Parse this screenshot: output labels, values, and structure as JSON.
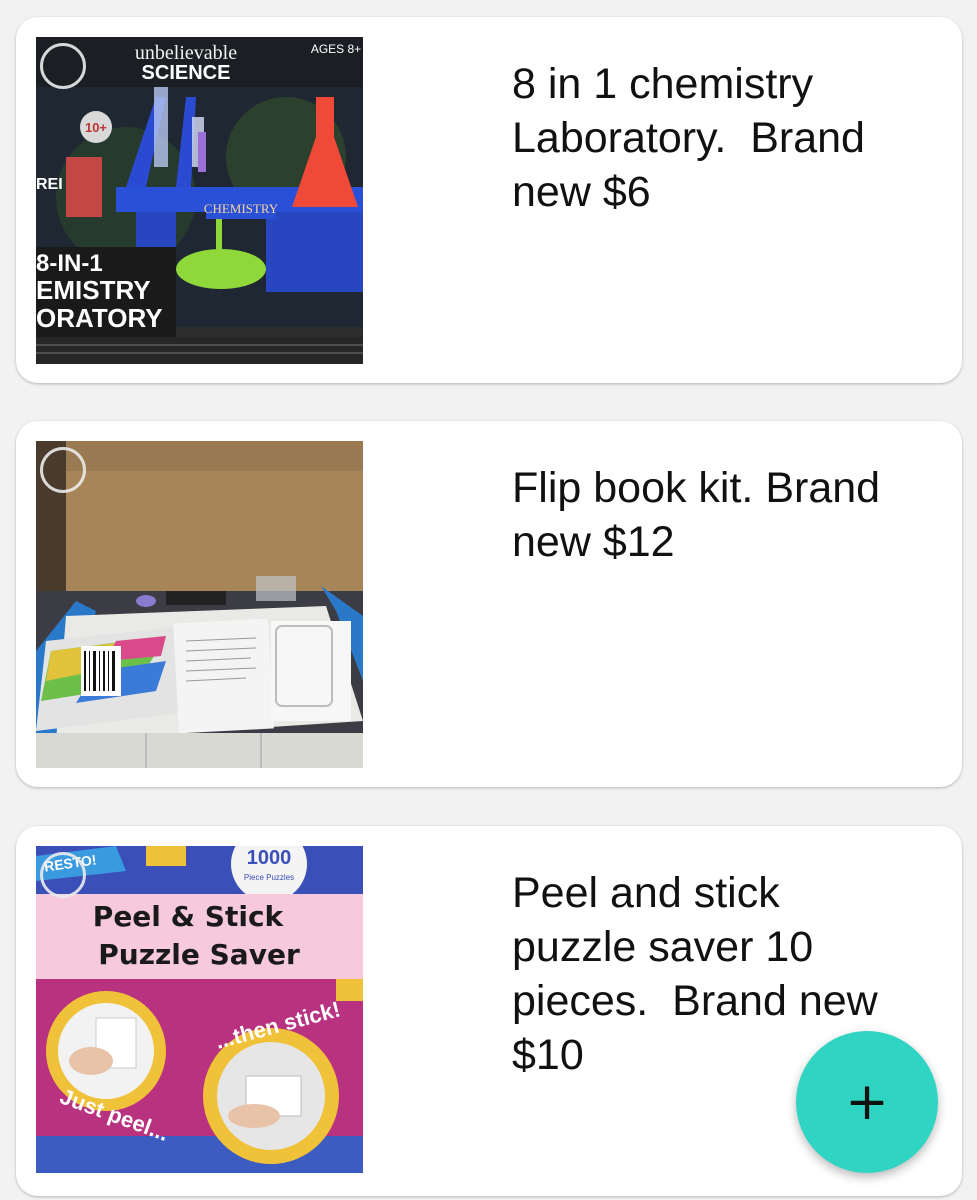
{
  "listings": [
    {
      "description": "8 in 1 chemistry\nLaboratory.  Brand\nnew $6",
      "image_text": {
        "brand_top": "unbelievable",
        "brand_main": "SCIENCE",
        "ages": "AGES 8+",
        "box_label": "CHEMISTRY",
        "box_sub": "LABORATORY",
        "product_line1": "8-IN-1",
        "product_line2": "EMISTRY",
        "product_line3": "ORATORY",
        "badge": "10+",
        "side_text": "REI"
      }
    },
    {
      "description": "Flip book kit. Brand\nnew $12",
      "image_text": {}
    },
    {
      "description": "Peel and stick\npuzzle saver 10\npieces.  Brand new\n$10",
      "image_text": {
        "banner": "RESTO!",
        "badge_number": "1000",
        "badge_sub": "Piece Puzzles",
        "title_line1": "Peel & Stick",
        "title_line2": "Puzzle Saver",
        "step1": "Just peel...",
        "step2": "...then stick!"
      }
    }
  ],
  "fab": {
    "icon": "plus-icon",
    "glyph": "+",
    "color": "#2fd4c3"
  },
  "colors": {
    "background": "#f2f2f2",
    "card": "#ffffff",
    "text": "#111111",
    "accent": "#2fd4c3"
  }
}
